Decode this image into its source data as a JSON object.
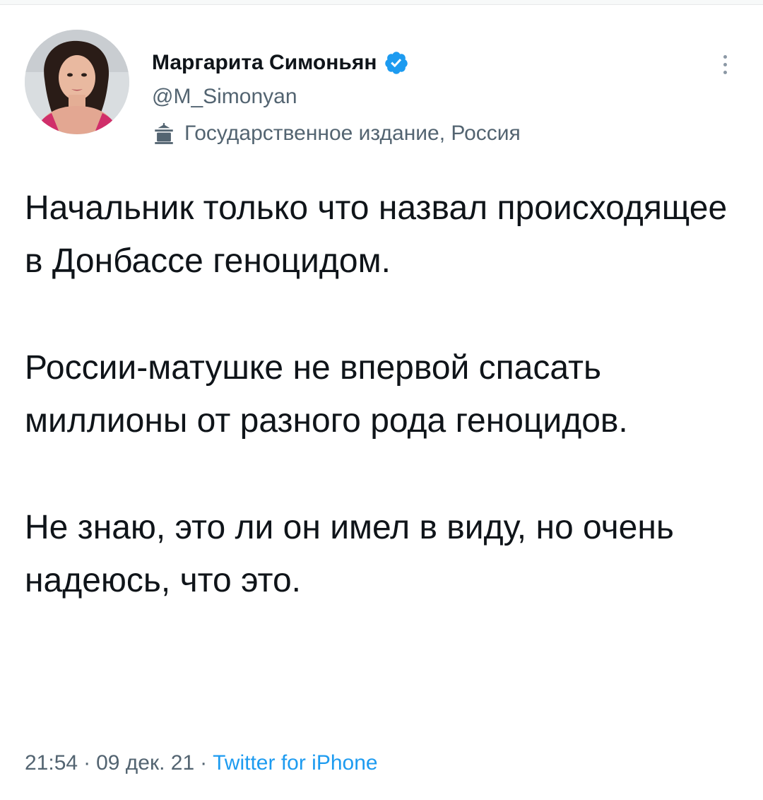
{
  "tweet": {
    "author": {
      "display_name": "Маргарита Симоньян",
      "handle": "@M_Simonyan",
      "verified": true,
      "verified_icon": "verified-badge-icon",
      "label_icon": "government-building-icon",
      "label": "Государственное издание, Россия"
    },
    "paragraphs": [
      "Начальник только что назвал происходящее в Донбассе геноцидом.",
      "России-матушке не впервой спасать миллионы от разного рода геноцидов.",
      "Не знаю, это ли он имел в виду, но очень надеюсь, что это."
    ],
    "meta": {
      "time": "21:54",
      "separator": "·",
      "date": "09 дек. 21",
      "source": "Twitter for iPhone"
    }
  },
  "colors": {
    "text_primary": "#0f1419",
    "text_secondary": "#536471",
    "accent": "#1d9bf0",
    "background": "#ffffff"
  }
}
